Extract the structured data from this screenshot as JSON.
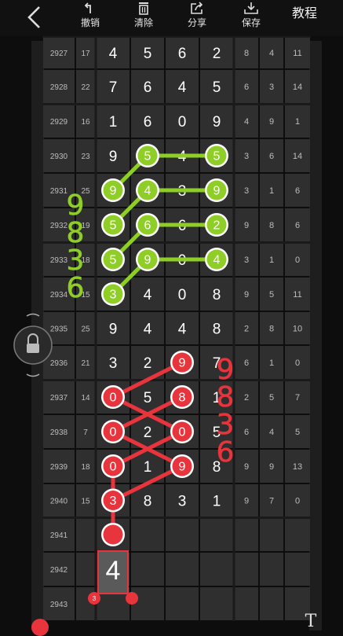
{
  "toolbar": {
    "undo_label": "撤销",
    "clear_label": "清除",
    "share_label": "分享",
    "save_label": "保存",
    "tutorial_label": "教程",
    "icons": [
      "back-arrow-icon",
      "undo-icon",
      "trash-icon",
      "share-icon",
      "save-icon"
    ]
  },
  "table": {
    "rows": [
      {
        "issue": "2927",
        "sum": "17",
        "digits": [
          "4",
          "5",
          "6",
          "2"
        ],
        "extra": [
          "8",
          "4",
          "11"
        ]
      },
      {
        "issue": "2928",
        "sum": "22",
        "digits": [
          "7",
          "6",
          "4",
          "5"
        ],
        "extra": [
          "6",
          "3",
          "14"
        ]
      },
      {
        "issue": "2929",
        "sum": "16",
        "digits": [
          "1",
          "6",
          "0",
          "9"
        ],
        "extra": [
          "4",
          "9",
          "1"
        ]
      },
      {
        "issue": "2930",
        "sum": "23",
        "digits": [
          "9",
          "5",
          "4",
          "5"
        ],
        "extra": [
          "3",
          "6",
          "14"
        ]
      },
      {
        "issue": "2931",
        "sum": "25",
        "digits": [
          "9",
          "4",
          "3",
          "9"
        ],
        "extra": [
          "3",
          "1",
          "6"
        ]
      },
      {
        "issue": "2932",
        "sum": "19",
        "digits": [
          "5",
          "6",
          "6",
          "2"
        ],
        "extra": [
          "9",
          "8",
          "6"
        ]
      },
      {
        "issue": "2933",
        "sum": "18",
        "digits": [
          "5",
          "9",
          "0",
          "4"
        ],
        "extra": [
          "3",
          "1",
          "0"
        ]
      },
      {
        "issue": "2934",
        "sum": "15",
        "digits": [
          "3",
          "4",
          "0",
          "8"
        ],
        "extra": [
          "9",
          "5",
          "11"
        ]
      },
      {
        "issue": "2935",
        "sum": "25",
        "digits": [
          "9",
          "4",
          "4",
          "8"
        ],
        "extra": [
          "2",
          "8",
          "10"
        ]
      },
      {
        "issue": "2936",
        "sum": "21",
        "digits": [
          "3",
          "2",
          "9",
          "7"
        ],
        "extra": [
          "6",
          "1",
          "0"
        ]
      },
      {
        "issue": "2937",
        "sum": "14",
        "digits": [
          "0",
          "5",
          "8",
          "1"
        ],
        "extra": [
          "2",
          "5",
          "7"
        ]
      },
      {
        "issue": "2938",
        "sum": "7",
        "digits": [
          "0",
          "2",
          "0",
          "5"
        ],
        "extra": [
          "6",
          "4",
          "5"
        ]
      },
      {
        "issue": "2939",
        "sum": "18",
        "digits": [
          "0",
          "1",
          "9",
          "8"
        ],
        "extra": [
          "9",
          "9",
          "13"
        ]
      },
      {
        "issue": "2940",
        "sum": "15",
        "digits": [
          "3",
          "8",
          "3",
          "1"
        ],
        "extra": [
          "9",
          "7",
          "0"
        ]
      },
      {
        "issue": "2941",
        "sum": "",
        "digits": [
          "",
          "",
          "",
          ""
        ],
        "extra": [
          "",
          "",
          ""
        ]
      },
      {
        "issue": "2942",
        "sum": "",
        "digits": [
          "4",
          "",
          "",
          ""
        ],
        "extra": [
          "",
          "",
          ""
        ]
      },
      {
        "issue": "2943",
        "sum": "",
        "digits": [
          "",
          "",
          "",
          ""
        ],
        "extra": [
          "",
          "",
          ""
        ]
      }
    ]
  },
  "markers": {
    "green": [
      [
        3,
        1
      ],
      [
        3,
        3
      ],
      [
        4,
        0
      ],
      [
        4,
        1
      ],
      [
        4,
        3
      ],
      [
        5,
        0
      ],
      [
        5,
        1
      ],
      [
        5,
        3
      ],
      [
        6,
        0
      ],
      [
        6,
        1
      ],
      [
        6,
        3
      ],
      [
        7,
        0
      ]
    ],
    "red": [
      [
        9,
        2
      ],
      [
        10,
        0
      ],
      [
        10,
        2
      ],
      [
        11,
        0
      ],
      [
        11,
        2
      ],
      [
        12,
        0
      ],
      [
        12,
        2
      ],
      [
        13,
        0
      ],
      [
        14,
        0
      ]
    ],
    "green_links": [
      [
        [
          3,
          1
        ],
        [
          3,
          3
        ]
      ],
      [
        [
          4,
          0
        ],
        [
          3,
          1
        ]
      ],
      [
        [
          4,
          1
        ],
        [
          4,
          3
        ]
      ],
      [
        [
          5,
          0
        ],
        [
          4,
          1
        ]
      ],
      [
        [
          5,
          1
        ],
        [
          5,
          3
        ]
      ],
      [
        [
          6,
          0
        ],
        [
          5,
          1
        ]
      ],
      [
        [
          6,
          1
        ],
        [
          6,
          3
        ]
      ],
      [
        [
          7,
          0
        ],
        [
          6,
          1
        ]
      ]
    ],
    "red_links": [
      [
        [
          10,
          0
        ],
        [
          9,
          2
        ]
      ],
      [
        [
          11,
          0
        ],
        [
          10,
          2
        ]
      ],
      [
        [
          12,
          0
        ],
        [
          11,
          2
        ]
      ],
      [
        [
          13,
          0
        ],
        [
          12,
          2
        ]
      ],
      [
        [
          10,
          0
        ],
        [
          11,
          2
        ]
      ],
      [
        [
          11,
          0
        ],
        [
          12,
          2
        ]
      ],
      [
        [
          12,
          0
        ],
        [
          13,
          0
        ]
      ],
      [
        [
          13,
          0
        ],
        [
          14,
          0
        ]
      ]
    ]
  },
  "annotations": {
    "green_label": [
      "9",
      "8",
      "3",
      "6"
    ],
    "red_label": [
      "9",
      "8",
      "3",
      "6"
    ]
  },
  "input_box": {
    "value": "4",
    "badge": "3"
  },
  "colors": {
    "green": "#8fce26",
    "red": "#e8343c",
    "background": "#0d0d0d",
    "cell": "#2f2f2f",
    "grid": "#1a1a1a"
  },
  "tools": {
    "text_tool": "T"
  }
}
